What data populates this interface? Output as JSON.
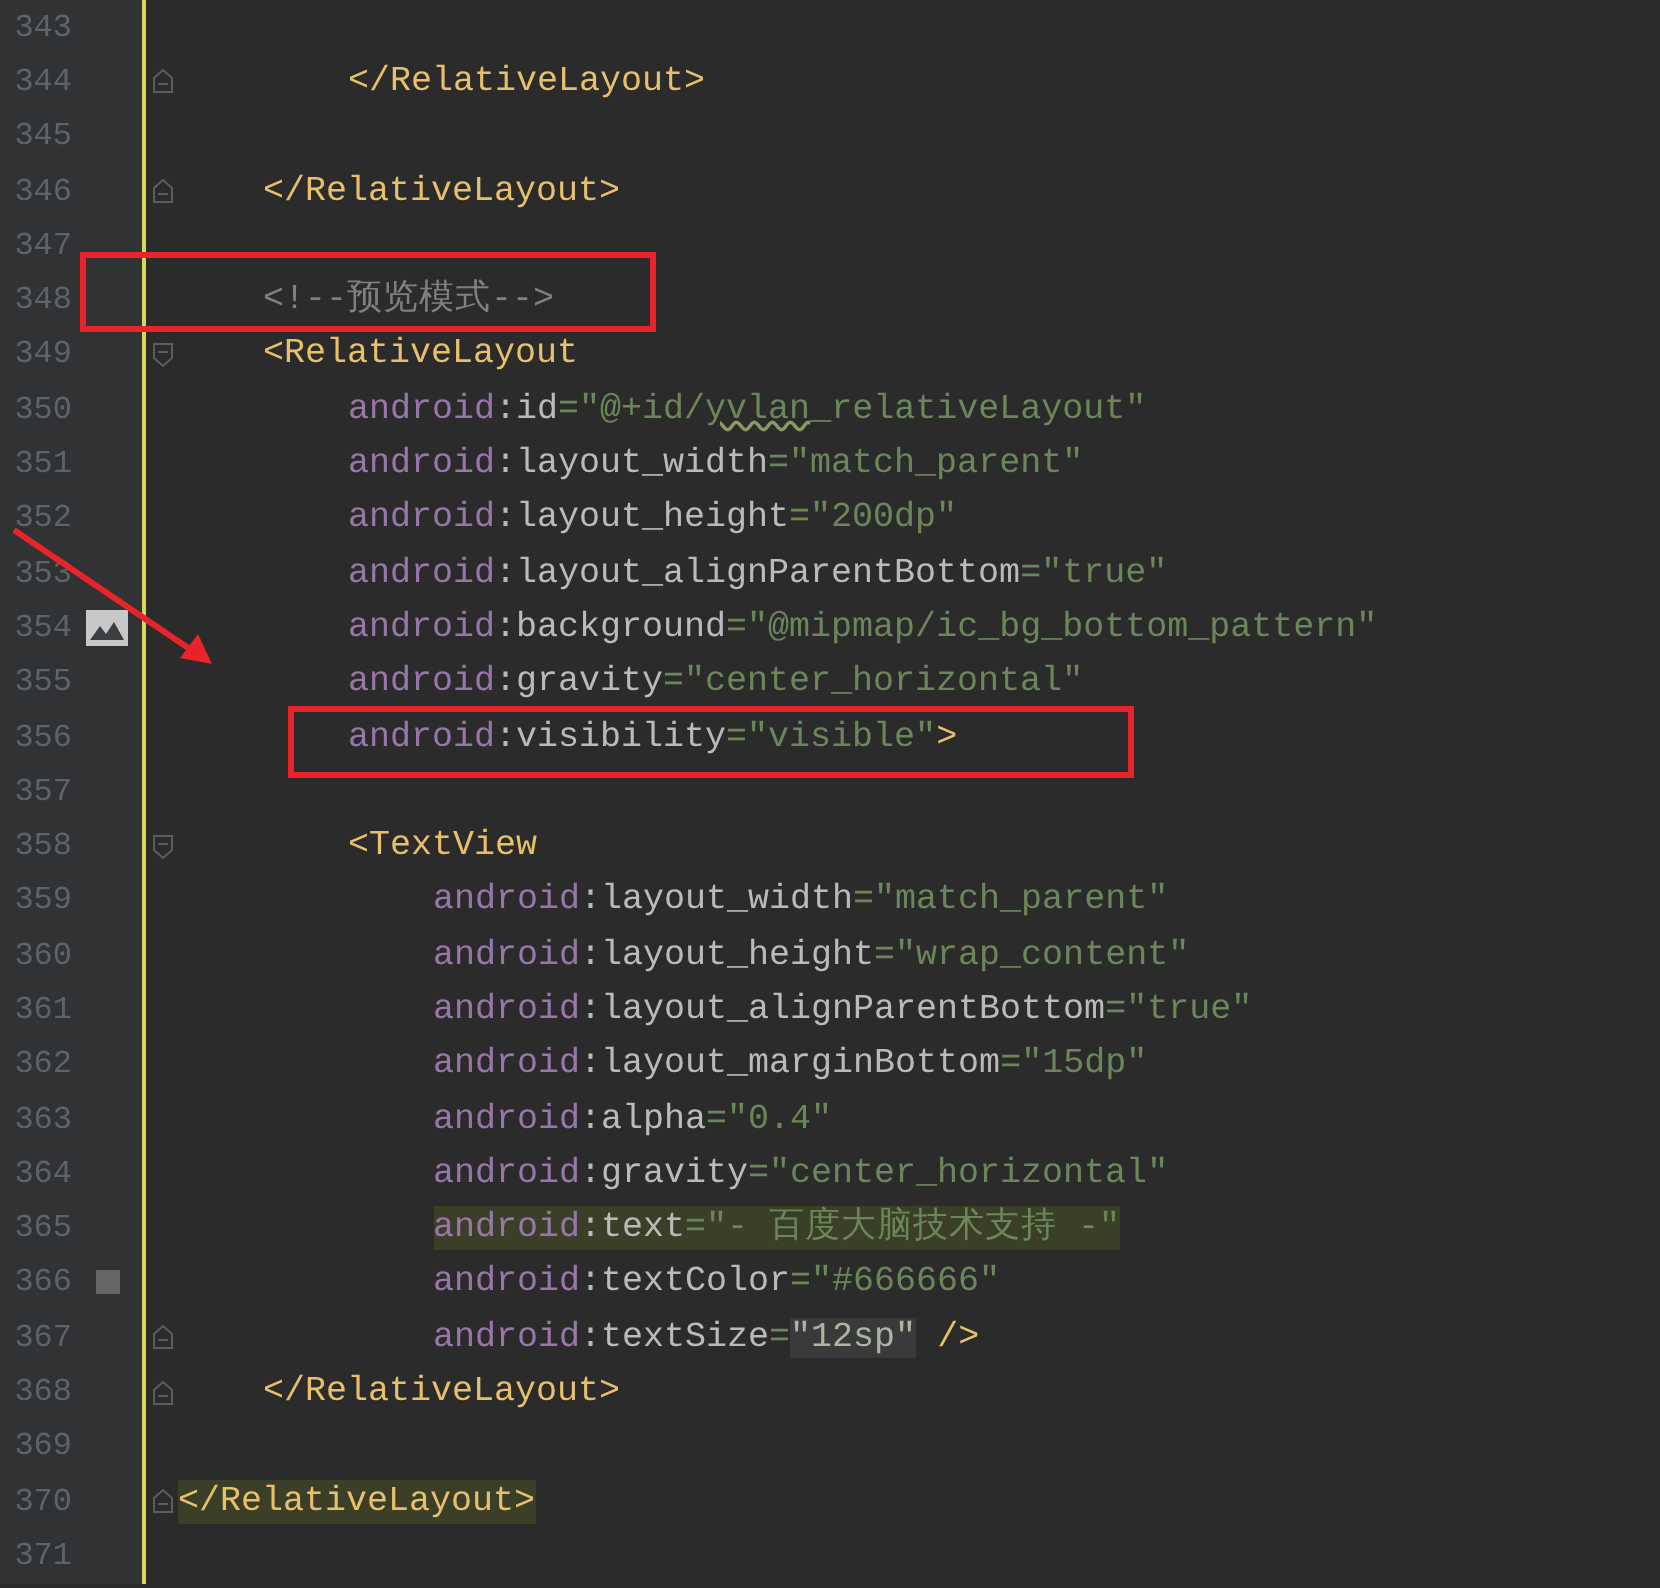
{
  "editor": {
    "lines": [
      {
        "kind": "blank",
        "number": "343"
      },
      {
        "kind": "group",
        "children": [
          {
            "kind": "group",
            "children": [
              {
                "kind": "code",
                "number": "344",
                "fold_marker": true,
                "tokens": [
                  {
                    "kind": "tag",
                    "text": "</RelativeLayout>"
                  }
                ]
              }
            ]
          },
          {
            "kind": "blank",
            "number": "345"
          },
          {
            "kind": "code",
            "number": "346",
            "fold_marker": true,
            "tokens": [
              {
                "kind": "tag",
                "text": "</RelativeLayout>"
              }
            ]
          },
          {
            "kind": "blank",
            "number": "347"
          },
          {
            "kind": "code",
            "number": "348",
            "tokens": [
              {
                "kind": "comment",
                "text": "<!--预览模式-->"
              }
            ]
          },
          {
            "kind": "code",
            "number": "349",
            "fold_marker": true,
            "tokens": [
              {
                "kind": "tag",
                "text": "<RelativeLayout"
              }
            ],
            "children": [
              {
                "kind": "code",
                "number": "350",
                "tokens": [
                  {
                    "kind": "ns",
                    "text": "android"
                  },
                  {
                    "kind": "attr",
                    "text": ":id"
                  },
                  {
                    "kind": "value",
                    "text": "=\"@+id/"
                  },
                  {
                    "kind": "value_misspelled",
                    "text": "yvlan"
                  },
                  {
                    "kind": "value",
                    "text": "_relativeLayout\""
                  }
                ]
              },
              {
                "kind": "code",
                "number": "351",
                "tokens": [
                  {
                    "kind": "ns",
                    "text": "android"
                  },
                  {
                    "kind": "attr",
                    "text": ":layout_width"
                  },
                  {
                    "kind": "value",
                    "text": "=\"match_parent\""
                  }
                ]
              },
              {
                "kind": "code",
                "number": "352",
                "tokens": [
                  {
                    "kind": "ns",
                    "text": "android"
                  },
                  {
                    "kind": "attr",
                    "text": ":layout_height"
                  },
                  {
                    "kind": "value",
                    "text": "=\"200dp\""
                  }
                ]
              },
              {
                "kind": "code",
                "number": "353",
                "tokens": [
                  {
                    "kind": "ns",
                    "text": "android"
                  },
                  {
                    "kind": "attr",
                    "text": ":layout_alignParentBottom"
                  },
                  {
                    "kind": "value",
                    "text": "=\"true\""
                  }
                ]
              },
              {
                "kind": "image_ref",
                "number": "354",
                "tokens": [
                  {
                    "kind": "ns",
                    "text": "android"
                  },
                  {
                    "kind": "attr",
                    "text": ":background"
                  },
                  {
                    "kind": "value",
                    "text": "=\"@mipmap/ic_bg_bottom_pattern\""
                  }
                ]
              },
              {
                "kind": "code",
                "number": "355",
                "tokens": [
                  {
                    "kind": "ns",
                    "text": "android"
                  },
                  {
                    "kind": "attr",
                    "text": ":gravity"
                  },
                  {
                    "kind": "value",
                    "text": "=\"center_horizontal\""
                  }
                ]
              },
              {
                "kind": "code",
                "number": "356",
                "tokens": [
                  {
                    "kind": "ns",
                    "text": "android"
                  },
                  {
                    "kind": "attr",
                    "text": ":visibility"
                  },
                  {
                    "kind": "value",
                    "text": "=\"visible\""
                  },
                  {
                    "kind": "tag",
                    "text": ">"
                  }
                ]
              },
              {
                "kind": "blank",
                "number": "357"
              },
              {
                "kind": "code",
                "number": "358",
                "fold_marker": true,
                "tokens": [
                  {
                    "kind": "tag",
                    "text": "<TextView"
                  }
                ],
                "children": [
                  {
                    "kind": "code",
                    "number": "359",
                    "tokens": [
                      {
                        "kind": "ns",
                        "text": "android"
                      },
                      {
                        "kind": "attr",
                        "text": ":layout_width"
                      },
                      {
                        "kind": "value",
                        "text": "=\"match_parent\""
                      }
                    ]
                  },
                  {
                    "kind": "code",
                    "number": "360",
                    "tokens": [
                      {
                        "kind": "ns",
                        "text": "android"
                      },
                      {
                        "kind": "attr",
                        "text": ":layout_height"
                      },
                      {
                        "kind": "value",
                        "text": "=\"wrap_content\""
                      }
                    ]
                  },
                  {
                    "kind": "code",
                    "number": "361",
                    "tokens": [
                      {
                        "kind": "ns",
                        "text": "android"
                      },
                      {
                        "kind": "attr",
                        "text": ":layout_alignParentBottom"
                      },
                      {
                        "kind": "value",
                        "text": "=\"true\""
                      }
                    ]
                  },
                  {
                    "kind": "code",
                    "number": "362",
                    "tokens": [
                      {
                        "kind": "ns",
                        "text": "android"
                      },
                      {
                        "kind": "attr",
                        "text": ":layout_marginBottom"
                      },
                      {
                        "kind": "value",
                        "text": "=\"15dp\""
                      }
                    ]
                  },
                  {
                    "kind": "code",
                    "number": "363",
                    "tokens": [
                      {
                        "kind": "ns",
                        "text": "android"
                      },
                      {
                        "kind": "attr",
                        "text": ":alpha"
                      },
                      {
                        "kind": "value",
                        "text": "=\"0.4\""
                      }
                    ]
                  },
                  {
                    "kind": "code",
                    "number": "364",
                    "tokens": [
                      {
                        "kind": "ns",
                        "text": "android"
                      },
                      {
                        "kind": "attr",
                        "text": ":gravity"
                      },
                      {
                        "kind": "value",
                        "text": "=\"center_horizontal\""
                      }
                    ]
                  },
                  {
                    "kind": "code",
                    "number": "365",
                    "highlighted": true,
                    "tokens": [
                      {
                        "kind": "ns",
                        "text": "android"
                      },
                      {
                        "kind": "attr",
                        "text": ":text"
                      },
                      {
                        "kind": "value",
                        "text": "=\"- 百度大脑技术支持 -\""
                      }
                    ]
                  },
                  {
                    "kind": "color_ref",
                    "number": "366",
                    "color": "#666666",
                    "tokens": [
                      {
                        "kind": "ns",
                        "text": "android"
                      },
                      {
                        "kind": "attr",
                        "text": ":textColor"
                      },
                      {
                        "kind": "value",
                        "text": "=\"#666666\""
                      }
                    ]
                  },
                  {
                    "kind": "code",
                    "number": "367",
                    "fold_marker": true,
                    "tokens": [
                      {
                        "kind": "ns",
                        "text": "android"
                      },
                      {
                        "kind": "attr",
                        "text": ":textSize"
                      },
                      {
                        "kind": "value",
                        "text": "="
                      },
                      {
                        "kind": "value_folded",
                        "text": "\"12sp\""
                      },
                      {
                        "kind": "tag",
                        "text": " />"
                      }
                    ]
                  }
                ]
              }
            ]
          },
          {
            "kind": "code",
            "number": "368",
            "fold_marker": true,
            "tokens": [
              {
                "kind": "tag",
                "text": "</RelativeLayout>"
              }
            ]
          },
          {
            "kind": "blank",
            "number": "369"
          }
        ]
      },
      {
        "kind": "code",
        "number": "370",
        "fold_marker": true,
        "highlighted": true,
        "tokens": [
          {
            "kind": "tag",
            "text": "</RelativeLayout>"
          }
        ]
      },
      {
        "kind": "blank",
        "number": "371"
      }
    ]
  }
}
